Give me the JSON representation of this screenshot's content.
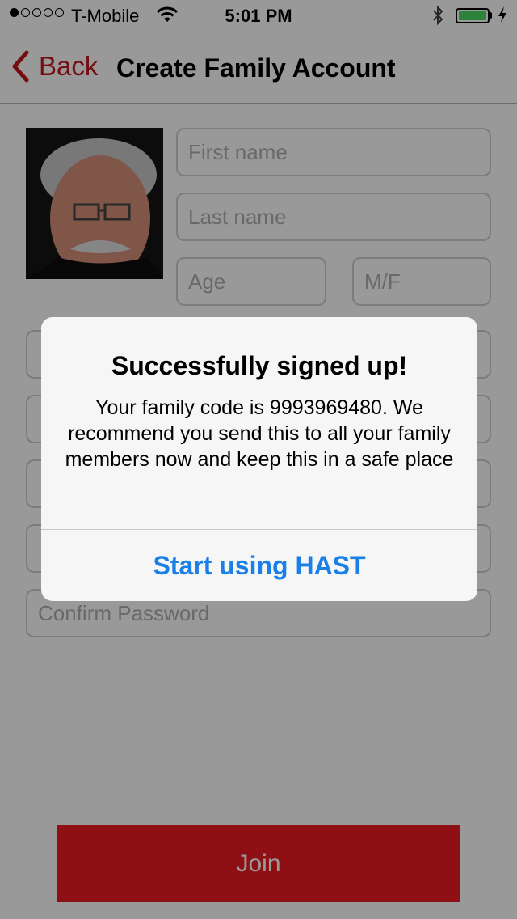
{
  "status_bar": {
    "carrier": "T-Mobile",
    "time": "5:01 PM",
    "signal_bars_filled": 1,
    "signal_bars_total": 5,
    "battery_level": 1.0
  },
  "nav": {
    "back_label": "Back",
    "title": "Create Family Account"
  },
  "form": {
    "first_name_placeholder": "First name",
    "last_name_placeholder": "Last name",
    "age_placeholder": "Age",
    "gender_placeholder": "M/F",
    "confirm_password_placeholder": "Confirm Password",
    "join_label": "Join"
  },
  "alert": {
    "title": "Successfully signed up!",
    "message": "Your family code is 9993969480. We recommend you send this to all your family members now and keep this in a safe place",
    "button_label": "Start using HAST"
  },
  "colors": {
    "accent_red": "#c1171f",
    "join_red": "#ed1c24",
    "ios_blue": "#1a7fe6",
    "battery_green": "#4cd964"
  }
}
